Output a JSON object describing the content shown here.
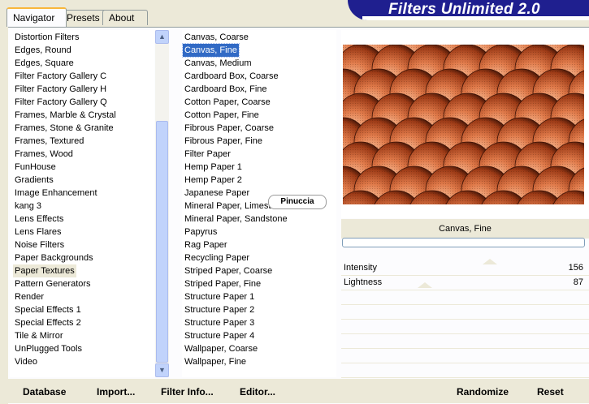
{
  "app": {
    "title": "Filters Unlimited 2.0"
  },
  "tabs": [
    {
      "label": "Navigator",
      "active": true
    },
    {
      "label": "Presets",
      "active": false
    },
    {
      "label": "About",
      "active": false
    }
  ],
  "categories": [
    "Distortion Filters",
    "Edges, Round",
    "Edges, Square",
    "Filter Factory Gallery C",
    "Filter Factory Gallery H",
    "Filter Factory Gallery Q",
    "Frames, Marble & Crystal",
    "Frames, Stone & Granite",
    "Frames, Textured",
    "Frames, Wood",
    "FunHouse",
    "Gradients",
    "Image Enhancement",
    "kang 3",
    "Lens Effects",
    "Lens Flares",
    "Noise Filters",
    "Paper Backgrounds",
    "Paper Textures",
    "Pattern Generators",
    "Render",
    "Special Effects 1",
    "Special Effects 2",
    "Tile & Mirror",
    "UnPlugged Tools",
    "Video"
  ],
  "selected_category": "Paper Textures",
  "filters": [
    "Canvas, Coarse",
    "Canvas, Fine",
    "Canvas, Medium",
    "Cardboard Box, Coarse",
    "Cardboard Box, Fine",
    "Cotton Paper, Coarse",
    "Cotton Paper, Fine",
    "Fibrous Paper, Coarse",
    "Fibrous Paper, Fine",
    "Filter Paper",
    "Hemp Paper 1",
    "Hemp Paper 2",
    "Japanese Paper",
    "Mineral Paper, Limestone",
    "Mineral Paper, Sandstone",
    "Papyrus",
    "Rag Paper",
    "Recycling Paper",
    "Striped Paper, Coarse",
    "Striped Paper, Fine",
    "Structure Paper 1",
    "Structure Paper 2",
    "Structure Paper 3",
    "Structure Paper 4",
    "Wallpaper, Coarse",
    "Wallpaper, Fine"
  ],
  "selected_filter": "Canvas, Fine",
  "watermark": "Pinuccia",
  "preview": {
    "filter_name": "Canvas, Fine"
  },
  "sliders": [
    {
      "label": "Intensity",
      "value": "156"
    },
    {
      "label": "Lightness",
      "value": "87"
    }
  ],
  "buttons": {
    "database": "Database",
    "import": "Import...",
    "filter_info": "Filter Info...",
    "editor": "Editor...",
    "randomize": "Randomize",
    "reset": "Reset"
  },
  "colors": {
    "banner": "#1f1f8f",
    "selection": "#316ac5",
    "tab_highlight": "#f9b73a"
  }
}
